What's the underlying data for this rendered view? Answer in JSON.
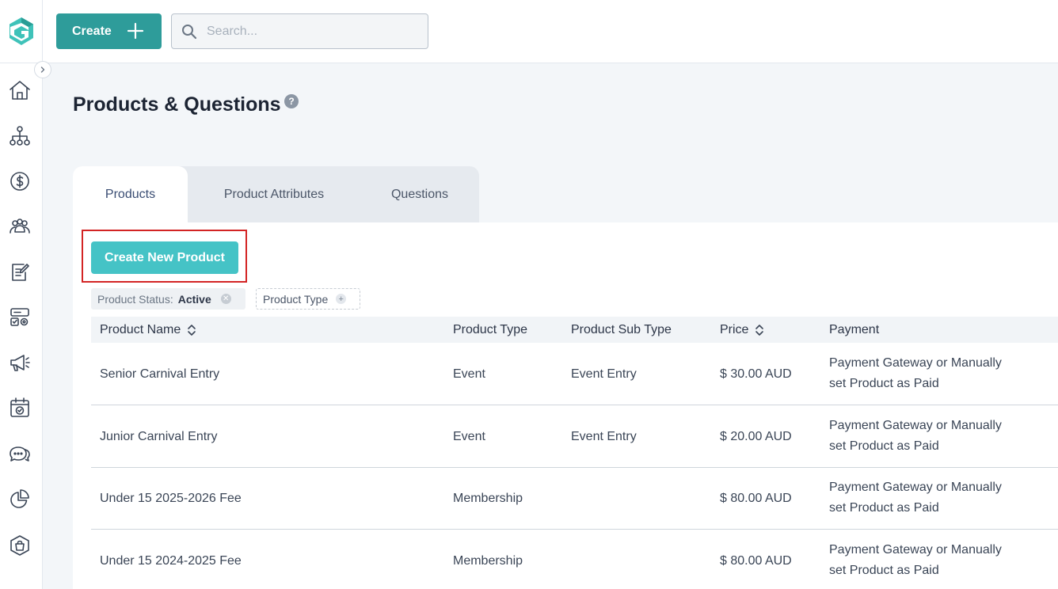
{
  "topbar": {
    "create_label": "Create",
    "search_placeholder": "Search..."
  },
  "page": {
    "title": "Products & Questions",
    "help": "?"
  },
  "tabs": [
    {
      "label": "Products",
      "active": true
    },
    {
      "label": "Product Attributes",
      "active": false
    },
    {
      "label": "Questions",
      "active": false
    }
  ],
  "actions": {
    "create_new_product": "Create New Product"
  },
  "filters": {
    "status_label": "Product Status:",
    "status_value": "Active",
    "type_label": "Product Type"
  },
  "table": {
    "columns": [
      "Product Name",
      "Product Type",
      "Product Sub Type",
      "Price",
      "Payment"
    ],
    "rows": [
      {
        "name": "Senior Carnival Entry",
        "type": "Event",
        "sub_type": "Event Entry",
        "price": "$ 30.00 AUD",
        "payment_line1": "Payment Gateway or Manually",
        "payment_line2": "set Product as Paid"
      },
      {
        "name": "Junior Carnival Entry",
        "type": "Event",
        "sub_type": "Event Entry",
        "price": "$ 20.00 AUD",
        "payment_line1": "Payment Gateway or Manually",
        "payment_line2": "set Product as Paid"
      },
      {
        "name": "Under 15 2025-2026 Fee",
        "type": "Membership",
        "sub_type": "",
        "price": "$ 80.00 AUD",
        "payment_line1": "Payment Gateway or Manually",
        "payment_line2": "set Product as Paid"
      },
      {
        "name": "Under 15 2024-2025 Fee",
        "type": "Membership",
        "sub_type": "",
        "price": "$ 80.00 AUD",
        "payment_line1": "Payment Gateway or Manually",
        "payment_line2": "set Product as Paid"
      }
    ]
  },
  "sidebar": {
    "icons": [
      "home-icon",
      "org-chart-icon",
      "dollar-icon",
      "members-icon",
      "forms-icon",
      "settings-card-icon",
      "megaphone-icon",
      "calendar-icon",
      "chat-icon",
      "pie-chart-icon",
      "shop-bag-icon"
    ]
  },
  "colors": {
    "accent": "#2e9c9a",
    "button_light": "#45c3c6",
    "highlight": "#d32424"
  }
}
